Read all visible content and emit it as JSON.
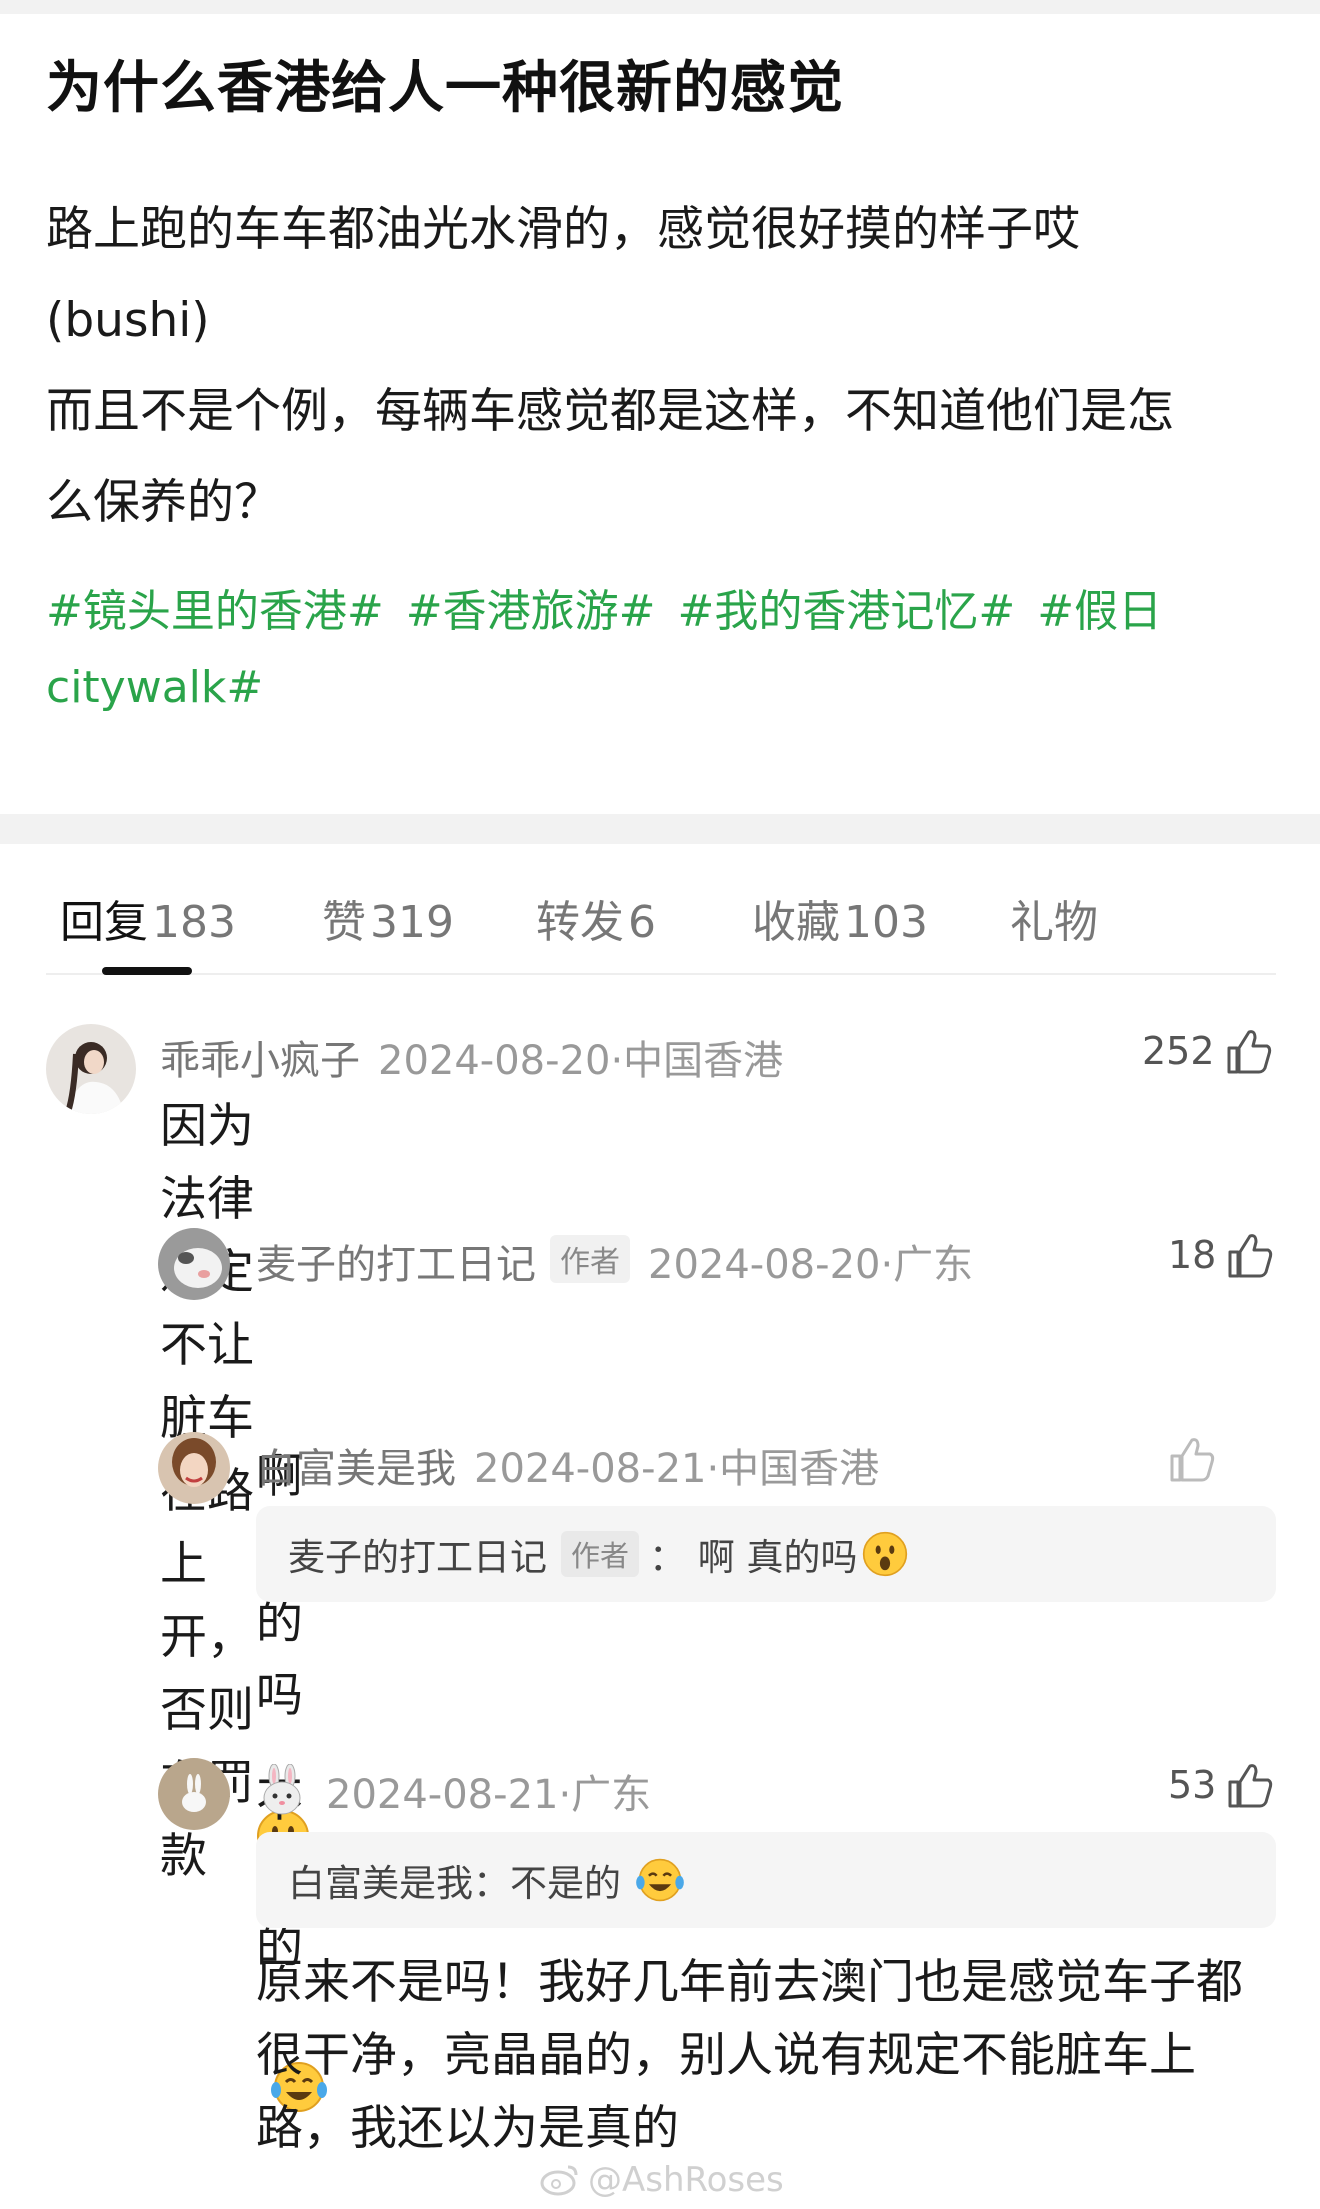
{
  "post": {
    "title": "为什么香港给人一种很新的感觉",
    "body": "路上跑的车车都油光水滑的，感觉很好摸的样子哎\n(bushi)\n而且不是个例，每辆车感觉都是这样，不知道他们是怎\n么保养的？",
    "hashtags": [
      "#镜头里的香港#",
      "#香港旅游#",
      "#我的香港记忆#",
      "#假日citywalk#"
    ]
  },
  "tabs": [
    {
      "label": "回复",
      "count": "183",
      "active": true
    },
    {
      "label": "赞",
      "count": "319",
      "active": false
    },
    {
      "label": "转发",
      "count": "6",
      "active": false
    },
    {
      "label": "收藏",
      "count": "103",
      "active": false
    },
    {
      "label": "礼物",
      "count": "",
      "active": false
    }
  ],
  "comments": [
    {
      "name": "乖乖小疯子",
      "date": "2024-08-20·中国香港",
      "text": "因为法律规定不让脏车在路上开，否则有罚款",
      "likes": "252"
    },
    {
      "name": "麦子的打工日记",
      "badge": "作者",
      "date": "2024-08-20·广东",
      "text": "啊 真的吗",
      "likes": "18"
    },
    {
      "name": "白富美是我",
      "date": "2024-08-21·中国香港",
      "quote_name": "麦子的打工日记",
      "quote_badge": "作者",
      "quote_text": "： 啊 真的吗",
      "text": "不是的",
      "likes": ""
    },
    {
      "name": "",
      "date": "2024-08-21·广东",
      "quote_text": "白富美是我：不是的",
      "text": "原来不是吗！我好几年前去澳门也是感觉车子都\n很干净，亮晶晶的，别人说有规定不能脏车上\n路，我还以为是真的",
      "likes": "53"
    }
  ],
  "watermark": "@AshRoses",
  "colors": {
    "hashtag": "#2aa44a",
    "meta": "#999999",
    "band": "#f2f2f2"
  }
}
